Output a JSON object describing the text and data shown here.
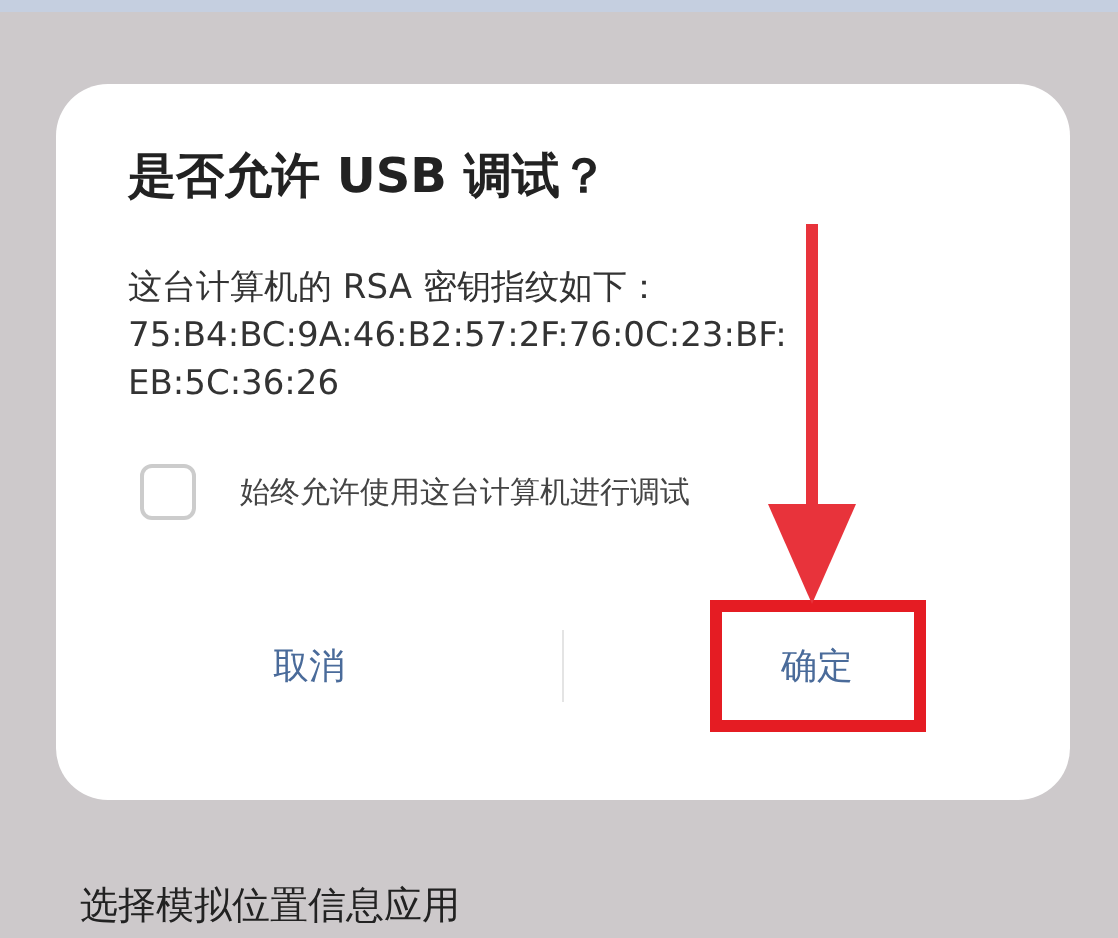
{
  "background": {
    "next_item": "选择模拟位置信息应用"
  },
  "dialog": {
    "title": "是否允许 USB 调试？",
    "message": "这台计算机的 RSA 密钥指纹如下：",
    "fingerprint": [
      "75:B4:BC:9A:46:B2:57:2F:76:0C:23:BF:",
      "EB:5C:36:26"
    ],
    "checkbox": {
      "label": "始终允许使用这台计算机进行调试",
      "checked": false
    },
    "buttons": [
      {
        "label": "取消",
        "highlighted": false
      },
      {
        "label": "确定",
        "highlighted": true
      }
    ]
  }
}
